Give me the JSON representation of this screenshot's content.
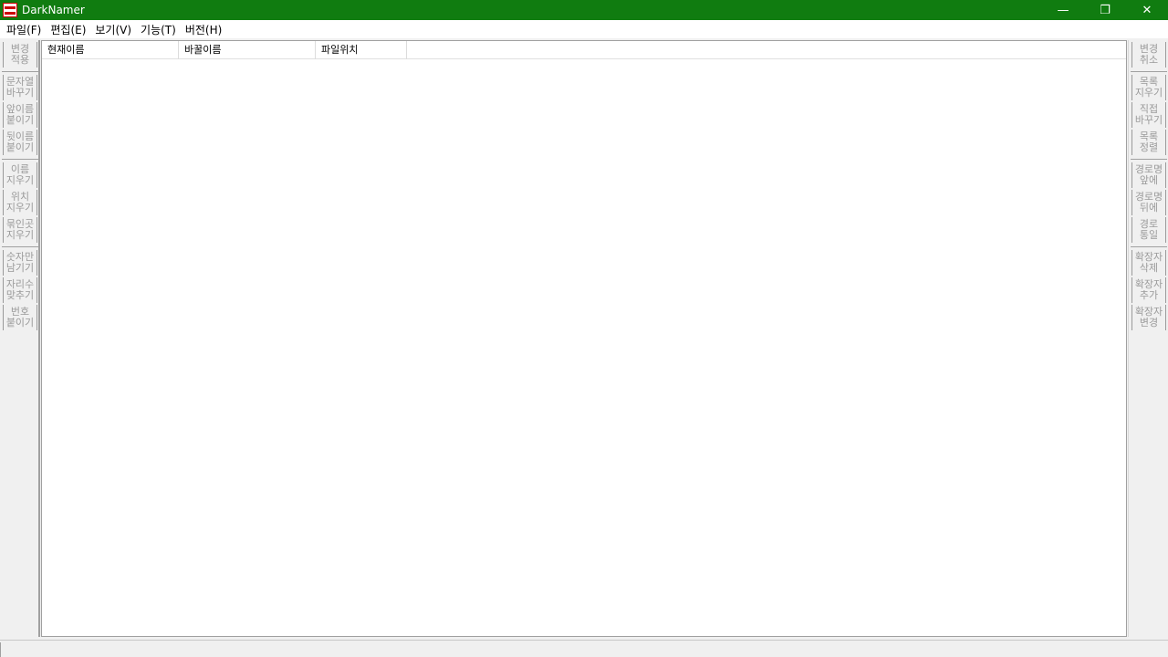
{
  "window": {
    "title": "DarkNamer",
    "icon": "darknamer-app-icon",
    "minimize": "—",
    "restore": "❐",
    "close": "✕"
  },
  "menu": [
    "파일(F)",
    "편집(E)",
    "보기(V)",
    "기능(T)",
    "버전(H)"
  ],
  "left_buttons": [
    [
      "변경",
      "적용"
    ],
    [
      "문자열",
      "바꾸기"
    ],
    [
      "앞이름",
      "붙이기"
    ],
    [
      "뒷이름",
      "붙이기"
    ],
    [
      "이름",
      "지우기"
    ],
    [
      "위치",
      "지우기"
    ],
    [
      "묶인곳",
      "지우기"
    ],
    [
      "숫자만",
      "남기기"
    ],
    [
      "자리수",
      "맞추기"
    ],
    [
      "번호",
      "붙이기"
    ]
  ],
  "right_buttons": [
    [
      "변경",
      "취소"
    ],
    [
      "목록",
      "지우기"
    ],
    [
      "직접",
      "바꾸기"
    ],
    [
      "목록",
      "정렬"
    ],
    [
      "경로명",
      "앞에"
    ],
    [
      "경로명",
      "뒤에"
    ],
    [
      "경로",
      "통일"
    ],
    [
      "확장자",
      "삭제"
    ],
    [
      "확장자",
      "추가"
    ],
    [
      "확장자",
      "변경"
    ]
  ],
  "columns": [
    "현재이름",
    "바꿀이름",
    "파일위치",
    ""
  ],
  "colors": {
    "titlebar": "#107c10",
    "disabled_text": "#9a9a9a"
  }
}
